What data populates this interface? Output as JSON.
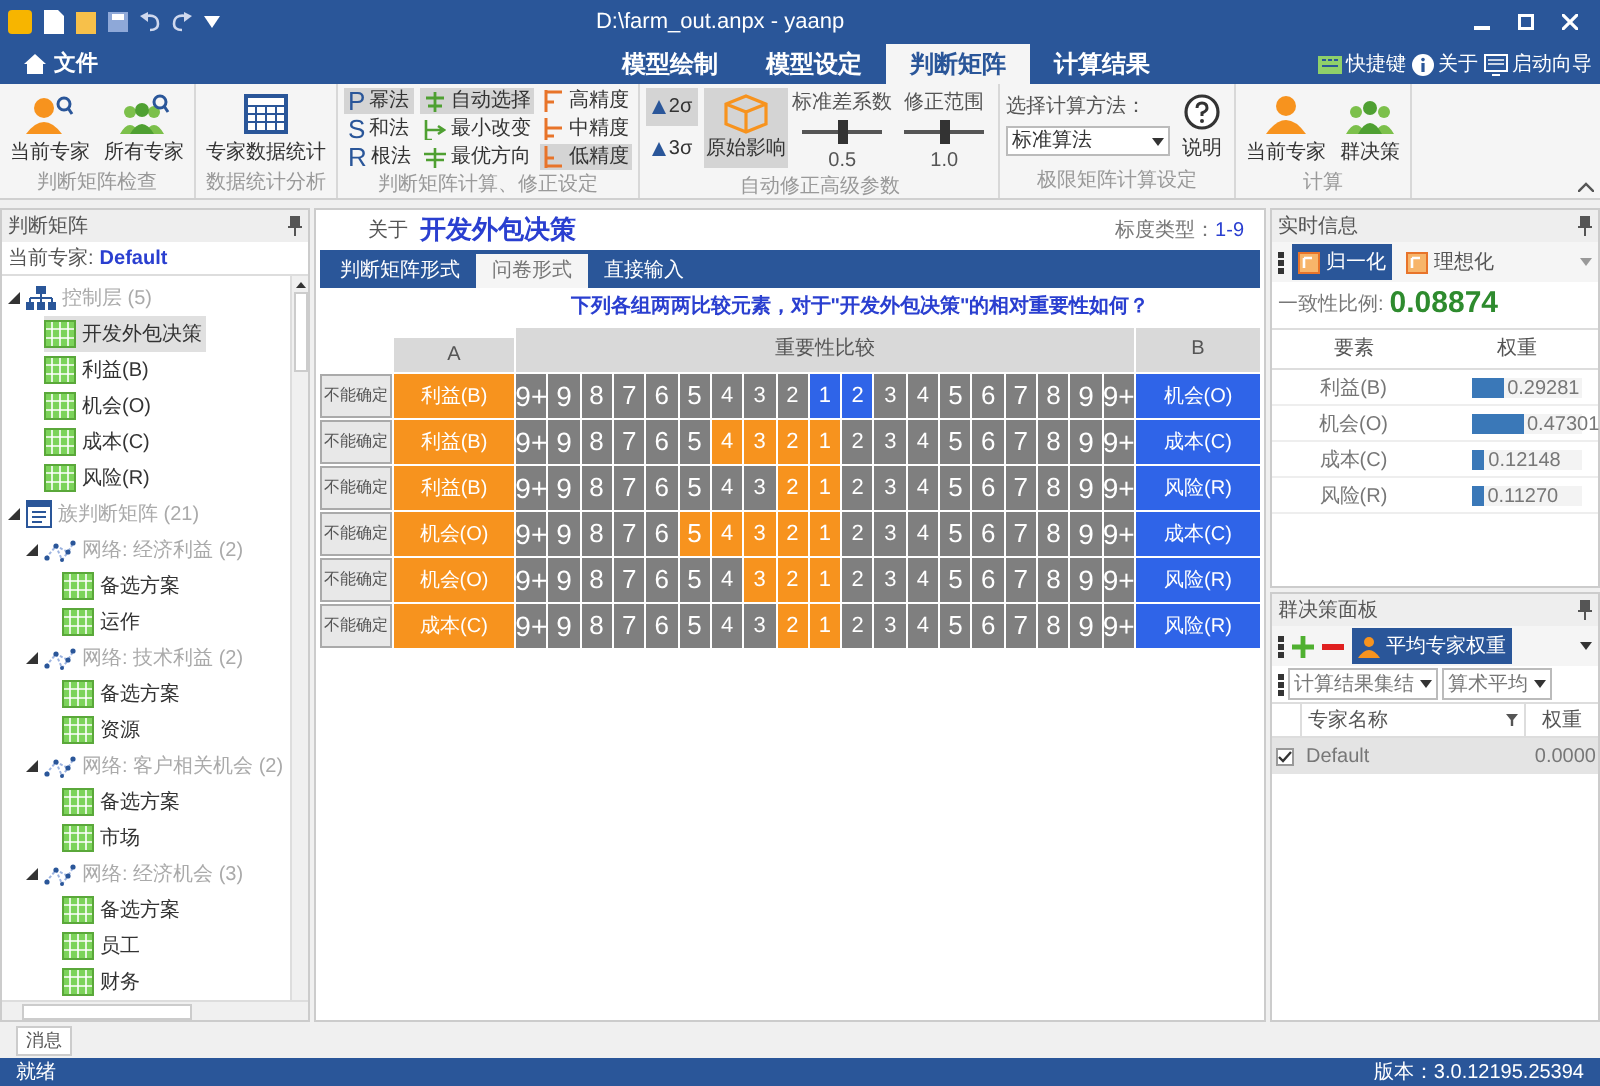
{
  "window": {
    "title": "D:\\farm_out.anpx - yaanp"
  },
  "ribbon": {
    "file_menu": "文件",
    "tabs": [
      {
        "label": "模型绘制",
        "selected": false
      },
      {
        "label": "模型设定",
        "selected": false
      },
      {
        "label": "判断矩阵",
        "selected": true
      },
      {
        "label": "计算结果",
        "selected": false
      }
    ],
    "links": [
      {
        "label": "快捷键"
      },
      {
        "label": "关于"
      },
      {
        "label": "启动向导"
      }
    ],
    "groups": [
      {
        "kind": "big_buttons",
        "label": "判断矩阵检查",
        "buttons": [
          {
            "label": "当前专家"
          },
          {
            "label": "所有专家"
          }
        ]
      },
      {
        "kind": "big_buttons",
        "label": "数据统计分析",
        "buttons": [
          {
            "label": "专家数据统计"
          }
        ]
      },
      {
        "kind": "options",
        "label": "判断矩阵计算、修正设定",
        "columns": [
          [
            {
              "letter": "P",
              "label": "幂法",
              "selected": true
            },
            {
              "letter": "S",
              "label": "和法",
              "selected": false
            },
            {
              "letter": "R",
              "label": "根法",
              "selected": false
            }
          ],
          [
            {
              "label": "自动选择",
              "selected": true
            },
            {
              "label": "最小改变",
              "selected": false
            },
            {
              "label": "最优方向",
              "selected": false
            }
          ],
          [
            {
              "label": "高精度",
              "selected": false
            },
            {
              "label": "中精度",
              "selected": false
            },
            {
              "label": "低精度",
              "selected": true
            }
          ]
        ]
      },
      {
        "kind": "params",
        "label": "自动修正高级参数",
        "sigmas": [
          {
            "label": "2σ",
            "selected": true
          },
          {
            "label": "3σ",
            "selected": false
          }
        ],
        "toggle": {
          "label": "原始影响",
          "selected": true
        },
        "sliders": [
          {
            "label": "标准差系数",
            "level": 0.5,
            "reading": "0.5"
          },
          {
            "label": "修正范围",
            "level": 0.5,
            "reading": "1.0"
          }
        ]
      },
      {
        "kind": "limit",
        "label": "极限矩阵计算设定",
        "prompt": "选择计算方法：",
        "value": "标准算法",
        "button": "说明"
      },
      {
        "kind": "big_buttons",
        "label": "计算",
        "buttons": [
          {
            "label": "当前专家"
          },
          {
            "label": "群决策"
          }
        ]
      }
    ]
  },
  "left_panel": {
    "title": "判断矩阵",
    "expert_label": "当前专家:",
    "expert": "Default",
    "tree": [
      {
        "kind": "hierarchy",
        "label": "控制层 (5)",
        "expanded": true,
        "selected": false,
        "children": [
          {
            "kind": "matrix",
            "label": "开发外包决策",
            "selected": true
          },
          {
            "kind": "matrix",
            "label": "利益(B)",
            "selected": false
          },
          {
            "kind": "matrix",
            "label": "机会(O)",
            "selected": false
          },
          {
            "kind": "matrix",
            "label": "成本(C)",
            "selected": false
          },
          {
            "kind": "matrix",
            "label": "风险(R)",
            "selected": false
          }
        ]
      },
      {
        "kind": "cluster",
        "label": "族判断矩阵 (21)",
        "expanded": true,
        "selected": false,
        "children": [
          {
            "kind": "network",
            "label": "网络: 经济利益 (2)",
            "expanded": true,
            "selected": false,
            "children": [
              {
                "kind": "matrix",
                "label": "备选方案",
                "selected": false
              },
              {
                "kind": "matrix",
                "label": "运作",
                "selected": false
              }
            ]
          },
          {
            "kind": "network",
            "label": "网络: 技术利益 (2)",
            "expanded": true,
            "selected": false,
            "children": [
              {
                "kind": "matrix",
                "label": "备选方案",
                "selected": false
              },
              {
                "kind": "matrix",
                "label": "资源",
                "selected": false
              }
            ]
          },
          {
            "kind": "network",
            "label": "网络: 客户相关机会 (2)",
            "expanded": true,
            "selected": false,
            "children": [
              {
                "kind": "matrix",
                "label": "备选方案",
                "selected": false
              },
              {
                "kind": "matrix",
                "label": "市场",
                "selected": false
              }
            ]
          },
          {
            "kind": "network",
            "label": "网络: 经济机会 (3)",
            "expanded": true,
            "selected": false,
            "children": [
              {
                "kind": "matrix",
                "label": "备选方案",
                "selected": false
              },
              {
                "kind": "matrix",
                "label": "员工",
                "selected": false
              },
              {
                "kind": "matrix",
                "label": "财务",
                "selected": false
              }
            ]
          }
        ]
      }
    ]
  },
  "center": {
    "about": "关于",
    "title": "开发外包决策",
    "scale_label": "标度类型：",
    "scale": "1-9",
    "tabs": [
      {
        "label": "判断矩阵形式",
        "selected": false
      },
      {
        "label": "问卷形式",
        "selected": true
      },
      {
        "label": "直接输入",
        "selected": false
      }
    ],
    "question": "下列各组两两比较元素，对于\"开发外包决策\"的相对重要性如何？",
    "headers": {
      "a": "A",
      "compare": "重要性比较",
      "b": "B"
    },
    "rows": [
      {
        "unsure": "不能确定",
        "a": "利益(B)",
        "b": "机会(O)",
        "b_preferred": true,
        "cells": [
          {
            "label": "9+",
            "selected": false
          },
          {
            "label": "9",
            "selected": false
          },
          {
            "label": "8",
            "selected": false
          },
          {
            "label": "7",
            "selected": false
          },
          {
            "label": "6",
            "selected": false
          },
          {
            "label": "5",
            "selected": false
          },
          {
            "label": "4",
            "selected": false
          },
          {
            "label": "3",
            "selected": false
          },
          {
            "label": "2",
            "selected": false
          },
          {
            "label": "1",
            "selected": true
          },
          {
            "label": "2",
            "selected": true
          },
          {
            "label": "3",
            "selected": false
          },
          {
            "label": "4",
            "selected": false
          },
          {
            "label": "5",
            "selected": false
          },
          {
            "label": "6",
            "selected": false
          },
          {
            "label": "7",
            "selected": false
          },
          {
            "label": "8",
            "selected": false
          },
          {
            "label": "9",
            "selected": false
          },
          {
            "label": "9+",
            "selected": false
          }
        ]
      },
      {
        "unsure": "不能确定",
        "a": "利益(B)",
        "b": "成本(C)",
        "b_preferred": false,
        "cells": [
          {
            "label": "9+",
            "selected": false
          },
          {
            "label": "9",
            "selected": false
          },
          {
            "label": "8",
            "selected": false
          },
          {
            "label": "7",
            "selected": false
          },
          {
            "label": "6",
            "selected": false
          },
          {
            "label": "5",
            "selected": false
          },
          {
            "label": "4",
            "selected": true
          },
          {
            "label": "3",
            "selected": true
          },
          {
            "label": "2",
            "selected": true
          },
          {
            "label": "1",
            "selected": true
          },
          {
            "label": "2",
            "selected": false
          },
          {
            "label": "3",
            "selected": false
          },
          {
            "label": "4",
            "selected": false
          },
          {
            "label": "5",
            "selected": false
          },
          {
            "label": "6",
            "selected": false
          },
          {
            "label": "7",
            "selected": false
          },
          {
            "label": "8",
            "selected": false
          },
          {
            "label": "9",
            "selected": false
          },
          {
            "label": "9+",
            "selected": false
          }
        ]
      },
      {
        "unsure": "不能确定",
        "a": "利益(B)",
        "b": "风险(R)",
        "b_preferred": false,
        "cells": [
          {
            "label": "9+",
            "selected": false
          },
          {
            "label": "9",
            "selected": false
          },
          {
            "label": "8",
            "selected": false
          },
          {
            "label": "7",
            "selected": false
          },
          {
            "label": "6",
            "selected": false
          },
          {
            "label": "5",
            "selected": false
          },
          {
            "label": "4",
            "selected": false
          },
          {
            "label": "3",
            "selected": false
          },
          {
            "label": "2",
            "selected": true
          },
          {
            "label": "1",
            "selected": true
          },
          {
            "label": "2",
            "selected": false
          },
          {
            "label": "3",
            "selected": false
          },
          {
            "label": "4",
            "selected": false
          },
          {
            "label": "5",
            "selected": false
          },
          {
            "label": "6",
            "selected": false
          },
          {
            "label": "7",
            "selected": false
          },
          {
            "label": "8",
            "selected": false
          },
          {
            "label": "9",
            "selected": false
          },
          {
            "label": "9+",
            "selected": false
          }
        ]
      },
      {
        "unsure": "不能确定",
        "a": "机会(O)",
        "b": "成本(C)",
        "b_preferred": false,
        "cells": [
          {
            "label": "9+",
            "selected": false
          },
          {
            "label": "9",
            "selected": false
          },
          {
            "label": "8",
            "selected": false
          },
          {
            "label": "7",
            "selected": false
          },
          {
            "label": "6",
            "selected": false
          },
          {
            "label": "5",
            "selected": true
          },
          {
            "label": "4",
            "selected": true
          },
          {
            "label": "3",
            "selected": true
          },
          {
            "label": "2",
            "selected": true
          },
          {
            "label": "1",
            "selected": true
          },
          {
            "label": "2",
            "selected": false
          },
          {
            "label": "3",
            "selected": false
          },
          {
            "label": "4",
            "selected": false
          },
          {
            "label": "5",
            "selected": false
          },
          {
            "label": "6",
            "selected": false
          },
          {
            "label": "7",
            "selected": false
          },
          {
            "label": "8",
            "selected": false
          },
          {
            "label": "9",
            "selected": false
          },
          {
            "label": "9+",
            "selected": false
          }
        ]
      },
      {
        "unsure": "不能确定",
        "a": "机会(O)",
        "b": "风险(R)",
        "b_preferred": false,
        "cells": [
          {
            "label": "9+",
            "selected": false
          },
          {
            "label": "9",
            "selected": false
          },
          {
            "label": "8",
            "selected": false
          },
          {
            "label": "7",
            "selected": false
          },
          {
            "label": "6",
            "selected": false
          },
          {
            "label": "5",
            "selected": false
          },
          {
            "label": "4",
            "selected": false
          },
          {
            "label": "3",
            "selected": true
          },
          {
            "label": "2",
            "selected": true
          },
          {
            "label": "1",
            "selected": true
          },
          {
            "label": "2",
            "selected": false
          },
          {
            "label": "3",
            "selected": false
          },
          {
            "label": "4",
            "selected": false
          },
          {
            "label": "5",
            "selected": false
          },
          {
            "label": "6",
            "selected": false
          },
          {
            "label": "7",
            "selected": false
          },
          {
            "label": "8",
            "selected": false
          },
          {
            "label": "9",
            "selected": false
          },
          {
            "label": "9+",
            "selected": false
          }
        ]
      },
      {
        "unsure": "不能确定",
        "a": "成本(C)",
        "b": "风险(R)",
        "b_preferred": false,
        "cells": [
          {
            "label": "9+",
            "selected": false
          },
          {
            "label": "9",
            "selected": false
          },
          {
            "label": "8",
            "selected": false
          },
          {
            "label": "7",
            "selected": false
          },
          {
            "label": "6",
            "selected": false
          },
          {
            "label": "5",
            "selected": false
          },
          {
            "label": "4",
            "selected": false
          },
          {
            "label": "3",
            "selected": false
          },
          {
            "label": "2",
            "selected": true
          },
          {
            "label": "1",
            "selected": true
          },
          {
            "label": "2",
            "selected": false
          },
          {
            "label": "3",
            "selected": false
          },
          {
            "label": "4",
            "selected": false
          },
          {
            "label": "5",
            "selected": false
          },
          {
            "label": "6",
            "selected": false
          },
          {
            "label": "7",
            "selected": false
          },
          {
            "label": "8",
            "selected": false
          },
          {
            "label": "9",
            "selected": false
          },
          {
            "label": "9+",
            "selected": false
          }
        ]
      }
    ]
  },
  "realtime": {
    "title": "实时信息",
    "modes": [
      {
        "label": "归一化",
        "selected": true
      },
      {
        "label": "理想化",
        "selected": false
      }
    ],
    "cr_label": "一致性比例:",
    "cr": "0.08874",
    "columns": [
      "要素",
      "权重"
    ],
    "rows": [
      {
        "name": "利益(B)",
        "level": 0.29281,
        "weight": "0.29281"
      },
      {
        "name": "机会(O)",
        "level": 0.47301,
        "weight": "0.47301"
      },
      {
        "name": "成本(C)",
        "level": 0.12148,
        "weight": "0.12148"
      },
      {
        "name": "风险(R)",
        "level": 0.1127,
        "weight": "0.11270"
      }
    ]
  },
  "group_panel": {
    "title": "群决策面板",
    "weight_button": "平均专家权重",
    "dropdowns": [
      "计算结果集结",
      "算术平均"
    ],
    "columns": [
      "专家名称",
      "权重"
    ],
    "rows": [
      {
        "name": "Default",
        "checked": true,
        "weight": "0.0000"
      }
    ]
  },
  "bottom_tab": "消息",
  "status_bar": {
    "text": "就绪",
    "version": "版本：3.0.12195.25394"
  }
}
